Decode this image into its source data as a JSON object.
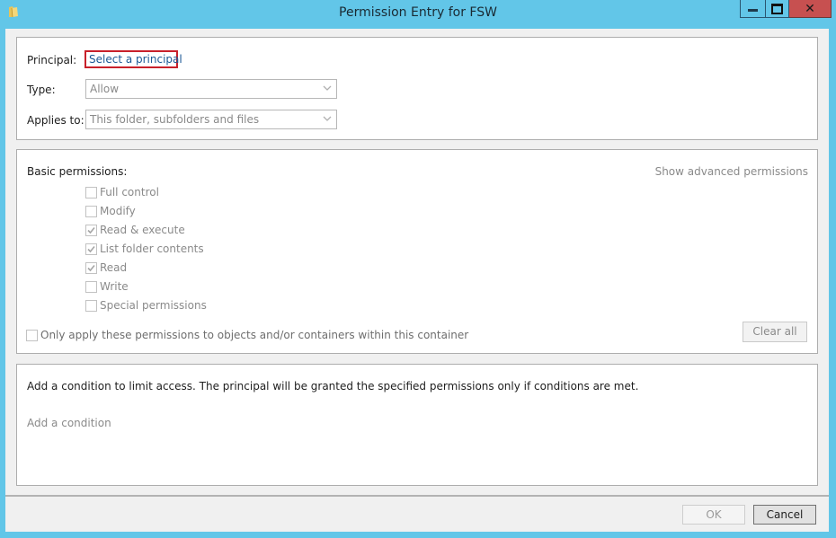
{
  "window": {
    "title": "Permission Entry for FSW",
    "icon": "folder-icon",
    "controls": [
      "minimize",
      "maximize",
      "close"
    ],
    "accent_color": "#62c6e8",
    "close_color": "#c75050"
  },
  "principal_section": {
    "principal_label": "Principal:",
    "principal_link": "Select a principal",
    "type_label": "Type:",
    "type_value": "Allow",
    "applies_label": "Applies to:",
    "applies_value": "This folder, subfolders and files"
  },
  "permissions_section": {
    "heading": "Basic permissions:",
    "advanced_link": "Show advanced permissions",
    "items": [
      {
        "label": "Full control",
        "checked": false
      },
      {
        "label": "Modify",
        "checked": false
      },
      {
        "label": "Read & execute",
        "checked": true
      },
      {
        "label": "List folder contents",
        "checked": true
      },
      {
        "label": "Read",
        "checked": true
      },
      {
        "label": "Write",
        "checked": false
      },
      {
        "label": "Special permissions",
        "checked": false
      }
    ],
    "only_apply_label": "Only apply these permissions to objects and/or containers within this container",
    "only_apply_checked": false,
    "clear_all_label": "Clear all"
  },
  "condition_section": {
    "description": "Add a condition to limit access. The principal will be granted the specified permissions only if conditions are met.",
    "add_condition_link": "Add a condition"
  },
  "footer": {
    "ok_label": "OK",
    "cancel_label": "Cancel"
  }
}
